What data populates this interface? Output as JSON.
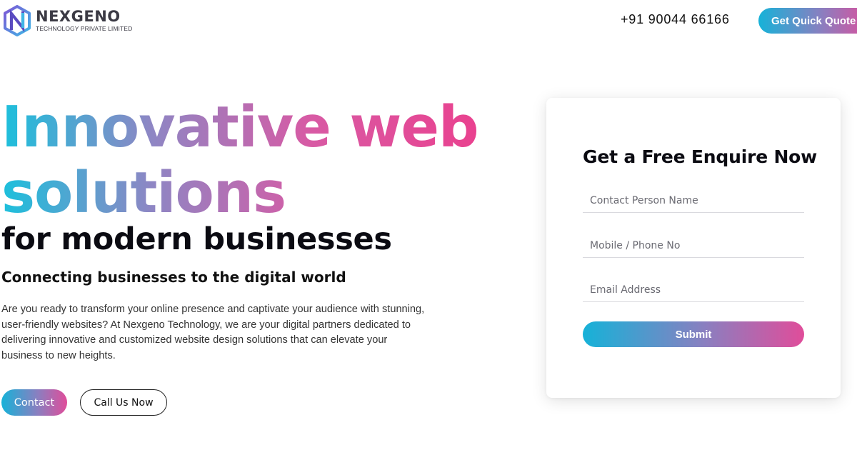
{
  "header": {
    "logo": {
      "name": "NEXGENO",
      "subtitle": "TECHNOLOGY PRIVATE LIMITED",
      "icon": "nexgeno-n-hexagon-logo"
    },
    "phone": "+91 90044 66166",
    "quote_button": "Get Quick Quote"
  },
  "hero": {
    "title_line1": "Innovative web",
    "title_line2": "solutions",
    "subtitle": "for modern businesses",
    "tagline": "Connecting businesses to the digital world",
    "description": "Are you ready to transform your online presence and captivate your audience with stunning, user-friendly websites? At Nexgeno Technology, we are your digital partners dedicated to delivering innovative and customized website design solutions that can elevate your business to new heights.",
    "contact_button": "Contact",
    "call_button": "Call Us Now"
  },
  "form": {
    "title": "Get a Free Enquire Now",
    "name_placeholder": "Contact Person Name",
    "phone_placeholder": "Mobile / Phone No",
    "email_placeholder": "Email Address",
    "submit": "Submit"
  },
  "colors": {
    "gradient_start": "#16b2d8",
    "gradient_mid": "#8a7fc0",
    "gradient_end": "#e04d9a",
    "logo_purple": "#6a4fc4",
    "logo_cyan": "#3fb7e6",
    "text_dark": "#0b0b12"
  }
}
